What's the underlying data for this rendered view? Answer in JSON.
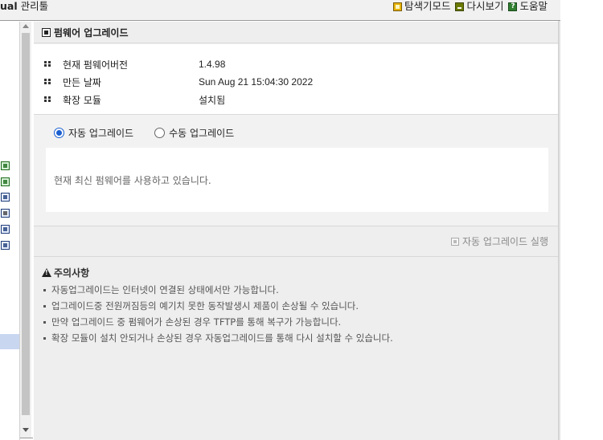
{
  "app": {
    "title_prefix": "ual",
    "title": "관리툴"
  },
  "top_links": [
    {
      "label": "탐색기모드",
      "icon": "explorer-mode-icon"
    },
    {
      "label": "다시보기",
      "icon": "refresh-view-icon"
    },
    {
      "label": "도움말",
      "icon": "help-icon"
    }
  ],
  "section": {
    "title": "펌웨어 업그레이드"
  },
  "info": [
    {
      "label": "현재 펌웨어버전",
      "value": "1.4.98"
    },
    {
      "label": "만든 날짜",
      "value": "Sun Aug 21 15:04:30 2022"
    },
    {
      "label": "확장 모듈",
      "value": "설치됨"
    }
  ],
  "upgrade_mode": {
    "auto_label": "자동 업그레이드",
    "manual_label": "수동 업그레이드",
    "selected": "auto"
  },
  "status_message": "현재 최신 펌웨어를 사용하고 있습니다.",
  "action": {
    "run_label": "자동 업그레이드 실행",
    "enabled": false
  },
  "notes": {
    "title": "주의사항",
    "items": [
      "자동업그레이드는 인터넷이 연결된 상태에서만 가능합니다.",
      "업그레이드중 전원꺼짐등의 예기치 못한 동작발생시 제품이 손상될 수 있습니다.",
      "만약 업그레이드 중 펌웨어가 손상된 경우 TFTP를 통해 복구가 가능합니다.",
      "확장 모듈이 설치 안되거나 손상된 경우 자동업그레이드를 통해 다시 설치할 수 있습니다."
    ]
  },
  "colors": {
    "accent": "#1a5fd0",
    "sidebar_highlight": "#c8d6f0"
  }
}
